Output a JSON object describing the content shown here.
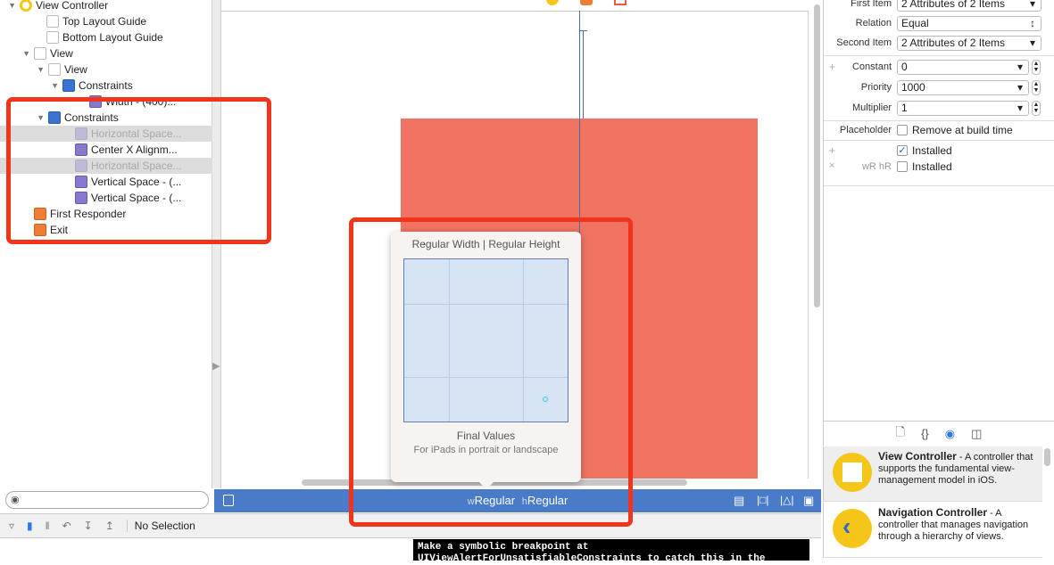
{
  "outline": {
    "items": [
      {
        "label": "View Controller",
        "icon": "view-controller-icon",
        "indent": 0,
        "expanded": true
      },
      {
        "label": "Top Layout Guide",
        "icon": "layout-guide-icon",
        "indent": 1
      },
      {
        "label": "Bottom Layout Guide",
        "icon": "layout-guide-icon",
        "indent": 1
      },
      {
        "label": "View",
        "icon": "view-icon",
        "indent": 1,
        "expanded": true
      },
      {
        "label": "View",
        "icon": "view-icon",
        "indent": 2,
        "expanded": true
      },
      {
        "label": "Constraints",
        "icon": "constraints-icon",
        "indent": 3,
        "expanded": true
      },
      {
        "label": "Width - (400)...",
        "icon": "constraint-icon",
        "indent": 4
      },
      {
        "label": "Constraints",
        "icon": "constraints-icon",
        "indent": 2,
        "expanded": true
      },
      {
        "label": "Horizontal Space...",
        "icon": "constraint-icon",
        "indent": 3,
        "selected": true
      },
      {
        "label": "Center X Alignm...",
        "icon": "constraint-icon",
        "indent": 3
      },
      {
        "label": "Horizontal Space...",
        "icon": "constraint-icon",
        "indent": 3,
        "selected": true
      },
      {
        "label": "Vertical Space - (...",
        "icon": "constraint-icon",
        "indent": 3
      },
      {
        "label": "Vertical Space - (...",
        "icon": "constraint-icon",
        "indent": 3
      },
      {
        "label": "First Responder",
        "icon": "first-responder-icon",
        "indent": 0
      },
      {
        "label": "Exit",
        "icon": "exit-icon",
        "indent": 0
      }
    ]
  },
  "canvas": {
    "view_color": "#f07361"
  },
  "popover": {
    "title": "Regular Width | Regular Height",
    "final_values": "Final Values",
    "subtitle": "For iPads in portrait or landscape"
  },
  "size_bar": {
    "w_prefix": "w",
    "w_value": "Regular",
    "h_prefix": "h",
    "h_value": "Regular",
    "color": "#4a7bc8"
  },
  "debug_bar": {
    "status": "No Selection"
  },
  "console": {
    "line1": "Make a symbolic breakpoint at",
    "line2": "UIViewAlertForUnsatisfiableConstraints to catch this in the"
  },
  "inspector": {
    "first_item_label": "First Item",
    "first_item": "2 Attributes of 2 Items",
    "relation_label": "Relation",
    "relation": "Equal",
    "second_item_label": "Second Item",
    "second_item": "2 Attributes of 2 Items",
    "constant_label": "Constant",
    "constant": "0",
    "priority_label": "Priority",
    "priority": "1000",
    "multiplier_label": "Multiplier",
    "multiplier": "1",
    "placeholder_label": "Placeholder",
    "placeholder_text": "Remove at build time",
    "placeholder_checked": false,
    "installed_text": "Installed",
    "installed_checked": true,
    "size_class_label": "wR hR",
    "installed2_text": "Installed",
    "installed2_checked": false
  },
  "library": {
    "items": [
      {
        "title": "View Controller",
        "desc": " - A controller that supports the fundamental view-management model in iOS."
      },
      {
        "title": "Navigation Controller",
        "desc": " - A controller that manages navigation through a hierarchy of views."
      }
    ]
  },
  "annotation_color": "#f2341c"
}
